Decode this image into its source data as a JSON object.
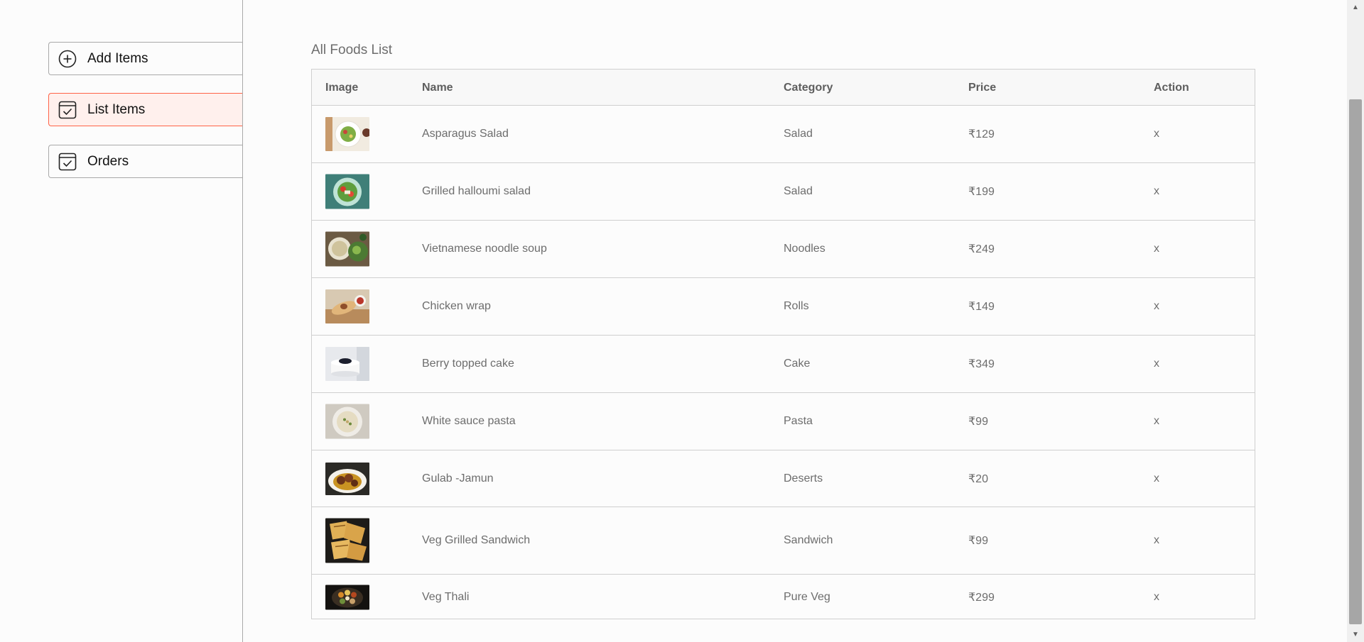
{
  "sidebar": {
    "items": [
      {
        "label": "Add Items",
        "icon": "add-circle-icon",
        "active": false
      },
      {
        "label": "List Items",
        "icon": "checklist-icon",
        "active": true
      },
      {
        "label": "Orders",
        "icon": "checklist-icon",
        "active": false
      }
    ]
  },
  "main": {
    "title": "All Foods List",
    "columns": [
      "Image",
      "Name",
      "Category",
      "Price",
      "Action"
    ],
    "rows": [
      {
        "name": "Asparagus Salad",
        "category": "Salad",
        "price": "₹129",
        "action": "x"
      },
      {
        "name": "Grilled halloumi salad",
        "category": "Salad",
        "price": "₹199",
        "action": "x"
      },
      {
        "name": "Vietnamese noodle soup",
        "category": "Noodles",
        "price": "₹249",
        "action": "x"
      },
      {
        "name": "Chicken wrap",
        "category": "Rolls",
        "price": "₹149",
        "action": "x"
      },
      {
        "name": "Berry topped cake",
        "category": "Cake",
        "price": "₹349",
        "action": "x"
      },
      {
        "name": "White sauce pasta",
        "category": "Pasta",
        "price": "₹99",
        "action": "x"
      },
      {
        "name": "Gulab -Jamun",
        "category": "Deserts",
        "price": "₹20",
        "action": "x"
      },
      {
        "name": "Veg Grilled Sandwich",
        "category": "Sandwich",
        "price": "₹99",
        "action": "x"
      },
      {
        "name": "Veg Thali",
        "category": "Pure Veg",
        "price": "₹299",
        "action": "x"
      }
    ]
  },
  "colors": {
    "accent": "#ff6347",
    "active_bg": "#fff0ed",
    "border": "#a9a9a9",
    "text": "#6d6d6d"
  }
}
